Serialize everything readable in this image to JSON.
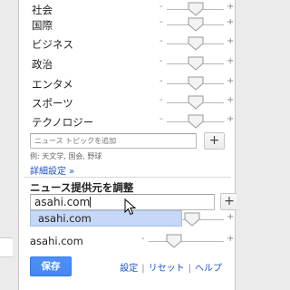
{
  "topics": [
    {
      "label": "社会",
      "level": 0.5
    },
    {
      "label": "国際",
      "level": 0.5
    },
    {
      "label": "ビジネス",
      "level": 0.5
    },
    {
      "label": "政治",
      "level": 0.5
    },
    {
      "label": "エンタメ",
      "level": 0.5
    },
    {
      "label": "スポーツ",
      "level": 0.5
    },
    {
      "label": "テクノロジー",
      "level": 0.5
    }
  ],
  "slider_minus": "-",
  "slider_plus": "+",
  "add_topic": {
    "placeholder": "ニュース トピックを追加",
    "button": "+",
    "example": "例: 天文学, 国会, 野球"
  },
  "detail_settings_link": "詳細設定 »",
  "sources": {
    "title": "ニュース提供元を調整",
    "input_value": "asahi.com",
    "button": "+",
    "suggestion": "asahi.com",
    "hidden_slider_level": 0.45,
    "items": [
      {
        "label": "asahi.com",
        "level": 0.28
      }
    ]
  },
  "footer": {
    "save": "保存",
    "settings": "設定",
    "reset": "リセット",
    "help": "ヘルプ",
    "separator": "|"
  },
  "colors": {
    "link": "#1a55c8",
    "save_button": "#4787ed",
    "suggestion_bg": "#c6d7f7"
  }
}
